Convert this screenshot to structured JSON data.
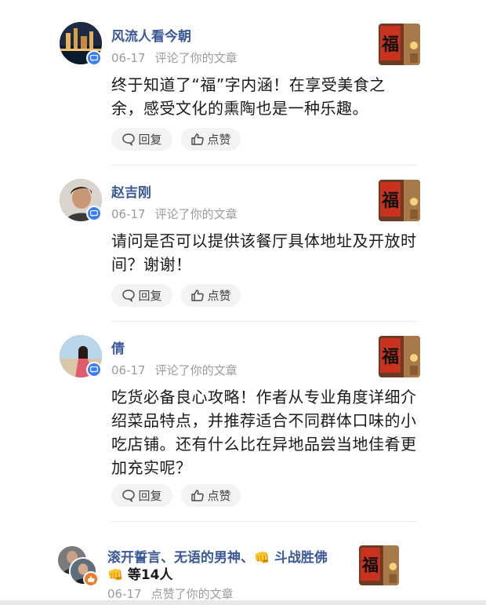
{
  "comments": [
    {
      "user": "风流人看今朝",
      "date": "06-17",
      "action": "评论了你的文章",
      "text": "终于知道了“福”字内涵！在享受美食之余，感受文化的熏陶也是一种乐趣。",
      "reply_label": "回复",
      "like_label": "点赞"
    },
    {
      "user": "赵吉刚",
      "date": "06-17",
      "action": "评论了你的文章",
      "text": "请问是否可以提供该餐厅具体地址及开放时间？谢谢！",
      "reply_label": "回复",
      "like_label": "点赞"
    },
    {
      "user": "倩",
      "date": "06-17",
      "action": "评论了你的文章",
      "text": "吃货必备良心攻略！作者从专业角度详细介绍菜品特点，并推荐适合不同群体口味的小吃店铺。还有什么比在异地品尝当地佳肴更加充实呢？",
      "reply_label": "回复",
      "like_label": "点赞"
    }
  ],
  "likes": {
    "names_1": "滚开誓言、无语的男神、",
    "names_2": "斗战胜佛",
    "count": "等14人",
    "date": "06-17",
    "action": "点赞了你的文章",
    "emoji": "👊"
  },
  "thumbnail_char": "福",
  "colors": {
    "name": "#3b5998",
    "badge_comment": "#3d7ef5",
    "badge_like": "#f07b2a",
    "meta": "#9b9b9b"
  }
}
